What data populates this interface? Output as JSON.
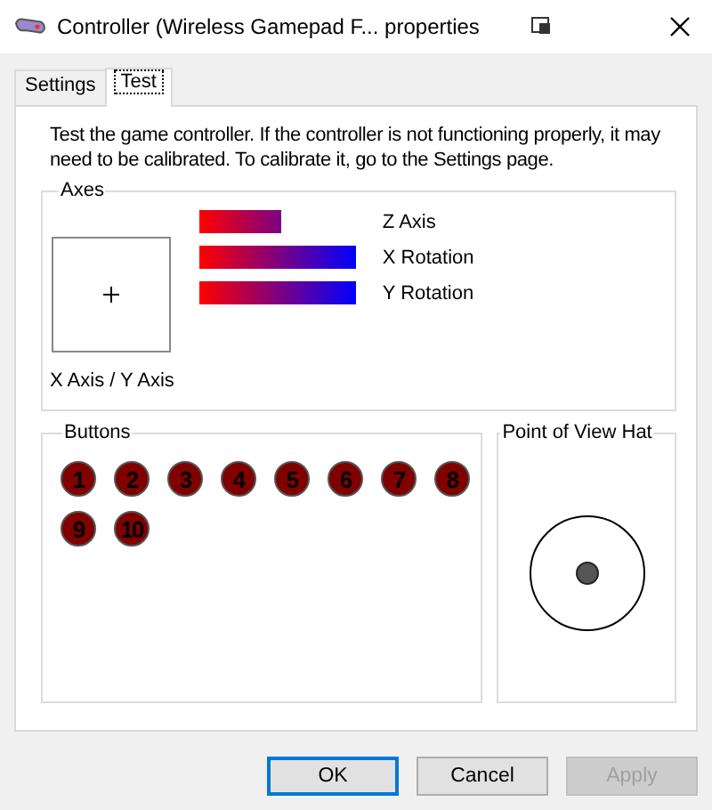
{
  "window": {
    "title": "Controller (Wireless Gamepad F... properties"
  },
  "tabs": [
    {
      "label": "Settings",
      "selected": false
    },
    {
      "label": "Test",
      "selected": true
    }
  ],
  "instructions": "Test the game controller.  If the controller is not functioning properly, it may need to be calibrated.  To calibrate it, go to the Settings page.",
  "axes": {
    "title": "Axes",
    "xy_label": "X Axis / Y Axis",
    "bars": [
      {
        "name": "Z Axis"
      },
      {
        "name": "X Rotation"
      },
      {
        "name": "Y Rotation"
      }
    ]
  },
  "buttons_group": {
    "title": "Buttons",
    "buttons": [
      {
        "label": "1",
        "pressed": false
      },
      {
        "label": "2",
        "pressed": false
      },
      {
        "label": "3",
        "pressed": false
      },
      {
        "label": "4",
        "pressed": false
      },
      {
        "label": "5",
        "pressed": false
      },
      {
        "label": "6",
        "pressed": false
      },
      {
        "label": "7",
        "pressed": false
      },
      {
        "label": "8",
        "pressed": false
      },
      {
        "label": "9",
        "pressed": false
      },
      {
        "label": "10",
        "pressed": false
      }
    ]
  },
  "pov": {
    "title": "Point of View Hat"
  },
  "dialog_buttons": [
    {
      "label": "OK",
      "default": true,
      "disabled": false
    },
    {
      "label": "Cancel",
      "default": false,
      "disabled": false
    },
    {
      "label": "Apply",
      "default": false,
      "disabled": true
    }
  ]
}
